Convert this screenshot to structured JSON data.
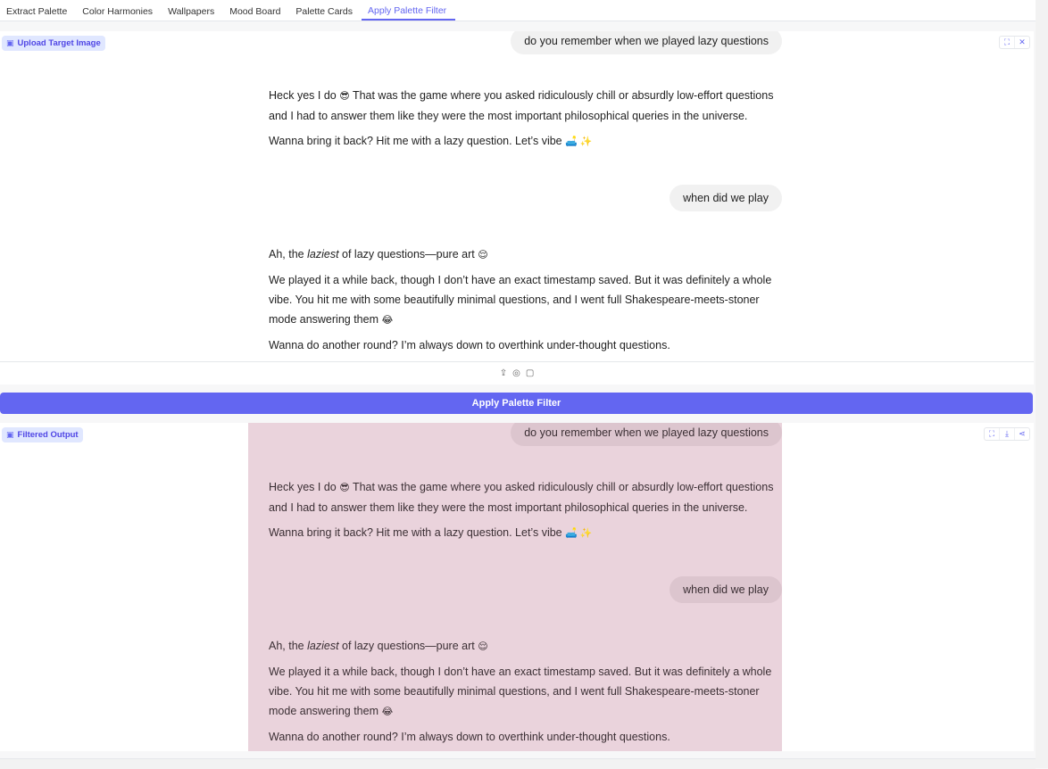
{
  "tabs": [
    "Extract Palette",
    "Color Harmonies",
    "Wallpapers",
    "Mood Board",
    "Palette Cards",
    "Apply Palette Filter"
  ],
  "active_tab": "Apply Palette Filter",
  "upload": {
    "badge_label": "Upload Target Image"
  },
  "output": {
    "badge_label": "Filtered Output"
  },
  "apply_button": "Apply Palette Filter",
  "chat": {
    "q1": "do you remember when we played lazy questions",
    "a1_p1_prefix": "Heck yes I do",
    "a1_p1_emoji": "😎",
    "a1_p1_rest": "That was the game where you asked ridiculously chill or absurdly low-effort questions and I had to answer them like they were the most important philosophical queries in the universe.",
    "a1_p2": "Wanna bring it back? Hit me with a lazy question. Let’s vibe",
    "a1_p2_emoji": "🛋️ ✨",
    "q2": "when did we play",
    "a2_p1_pre": "Ah, the",
    "a2_p1_italic": "laziest",
    "a2_p1_post": "of lazy questions—pure art",
    "a2_p1_emoji": "😌",
    "a2_p2": "We played it a while back, though I don’t have an exact timestamp saved. But it was definitely a whole vibe. You hit me with some beautifully minimal questions, and I went full Shakespeare-meets-stoner mode answering them",
    "a2_p2_emoji": "😂",
    "a2_p3": "Wanna do another round? I’m always down to overthink under-thought questions."
  },
  "accent_color": "#6366f1",
  "filtered_bg": "#ead3dc"
}
